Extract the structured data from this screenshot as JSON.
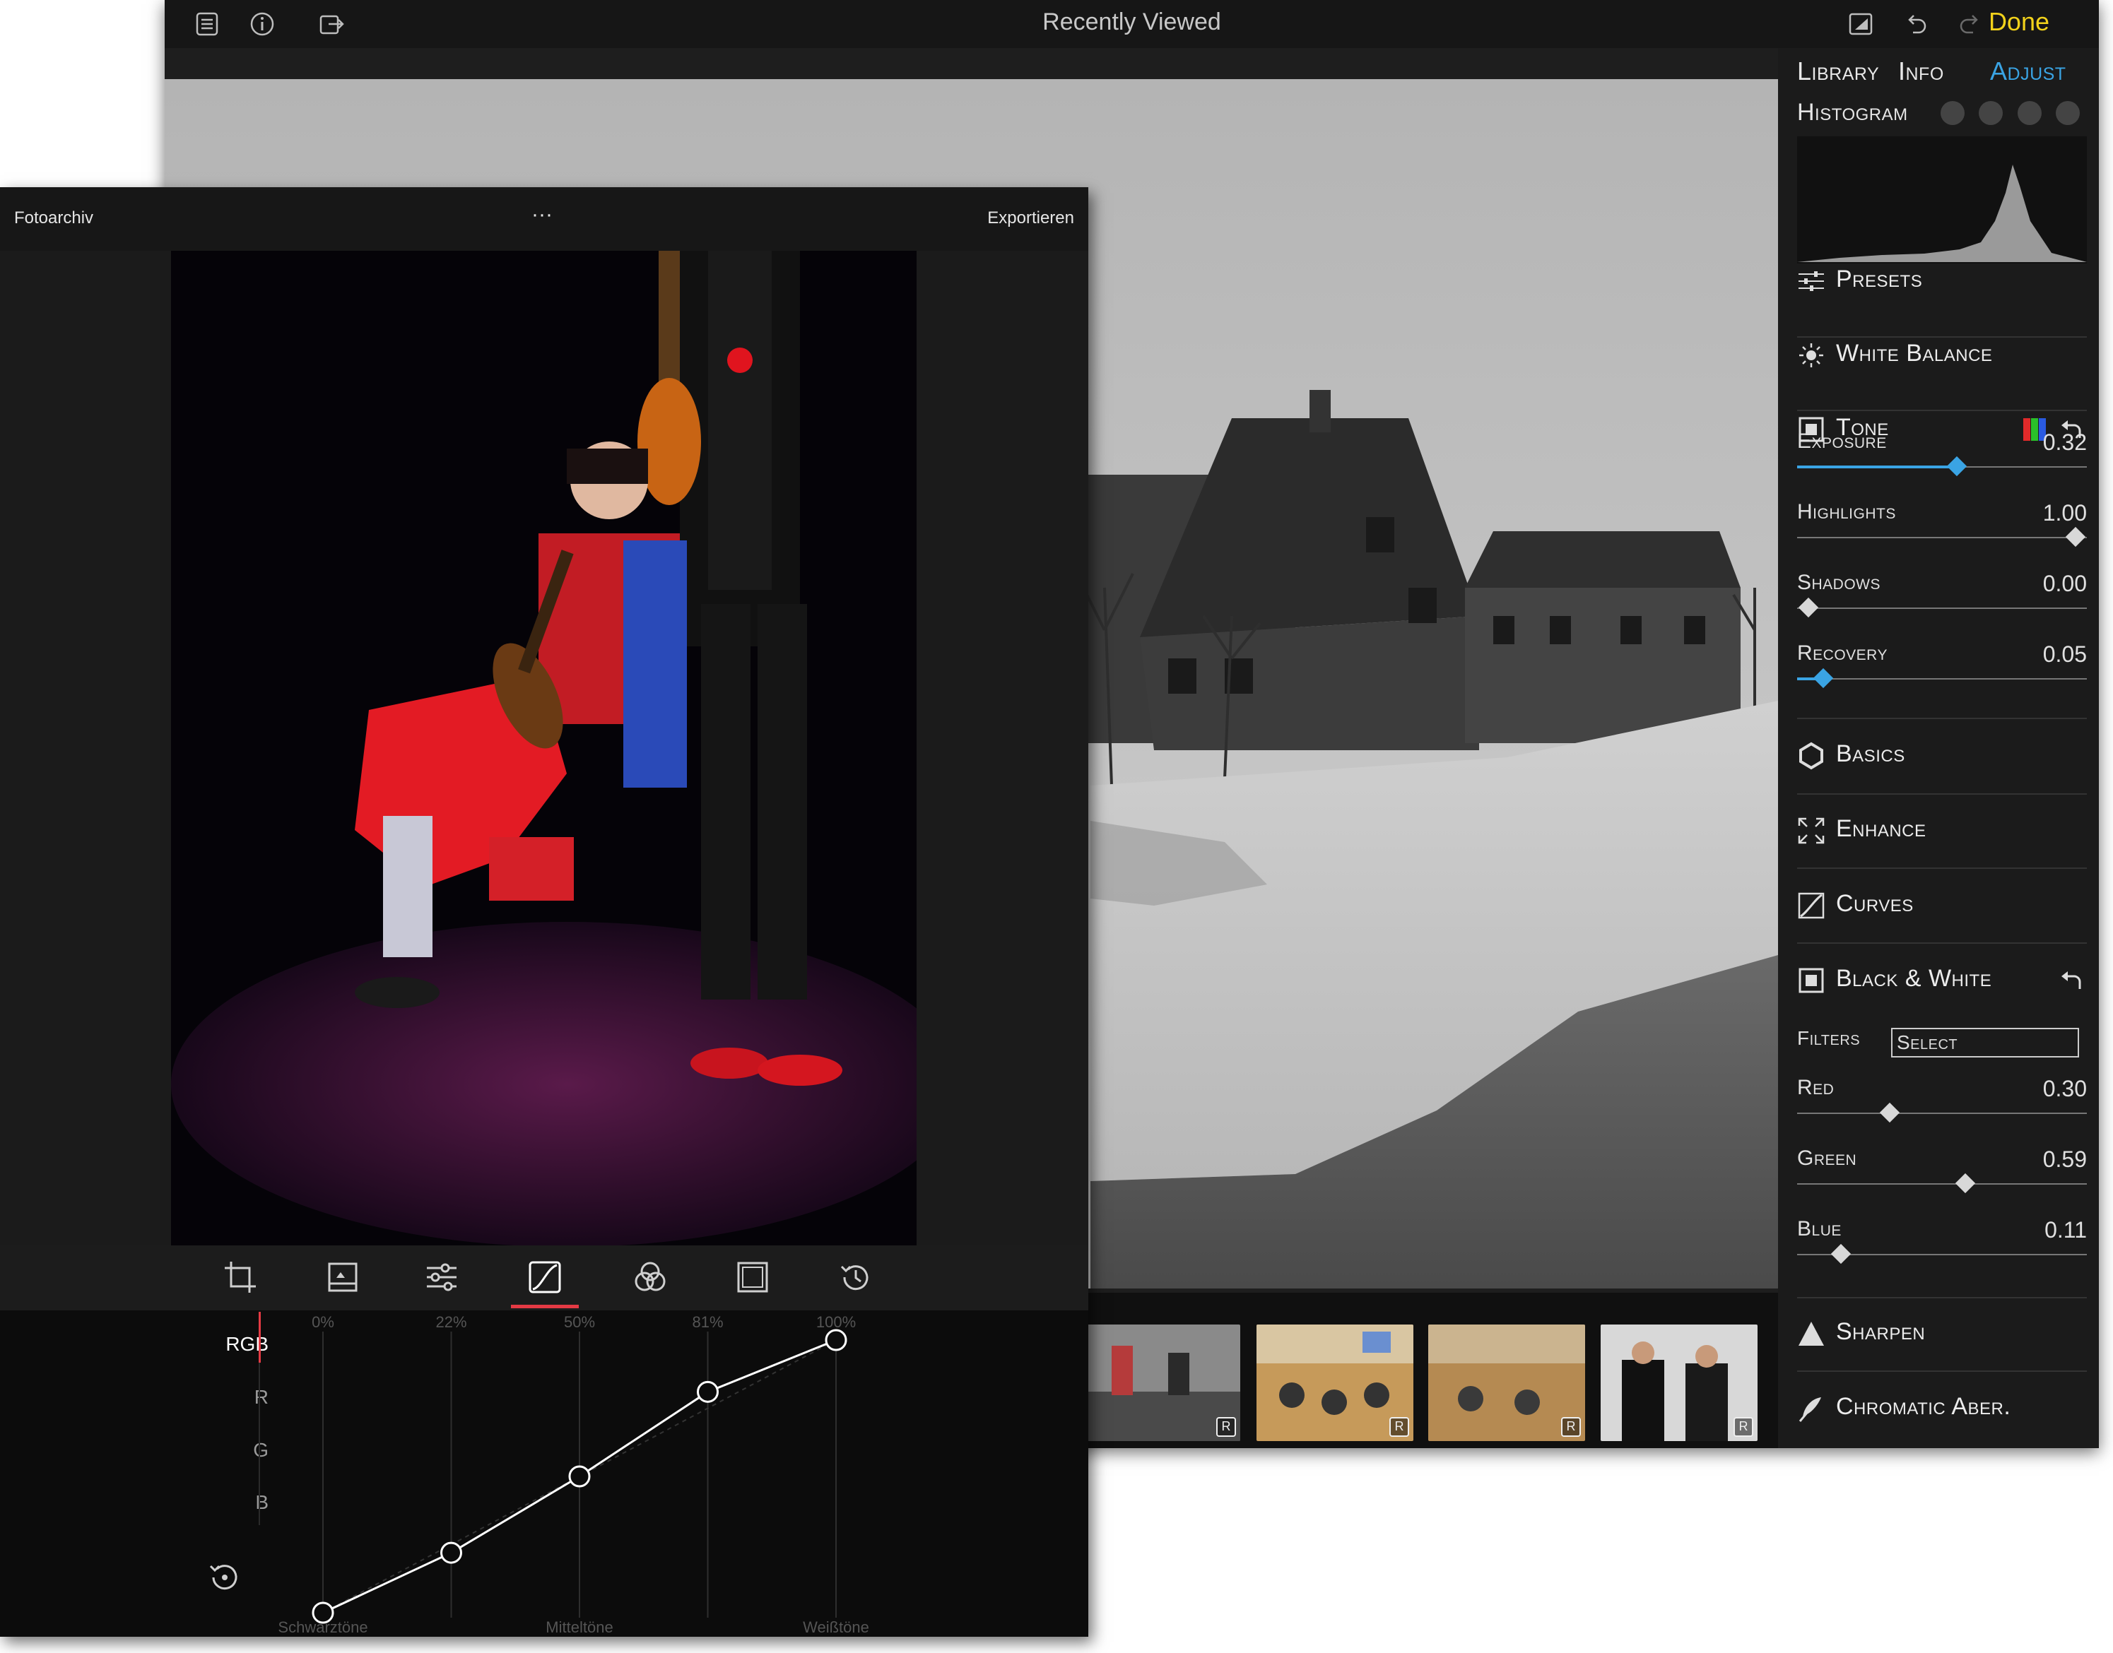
{
  "back_window": {
    "title": "Recently Viewed",
    "done_label": "Done",
    "icons": [
      "list-icon",
      "info-icon",
      "share-icon",
      "compare-icon",
      "undo-icon",
      "redo-icon"
    ],
    "filmstrip": {
      "thumbnails": [
        {
          "badge": "R"
        },
        {
          "badge": "R"
        },
        {
          "badge": "R"
        },
        {
          "badge": "R"
        }
      ]
    }
  },
  "right_panel": {
    "tabs": {
      "library": "Library",
      "info": "Info",
      "adjust": "Adjust"
    },
    "histogram_label": "Histogram",
    "sections": {
      "presets": "Presets",
      "white_balance": "White Balance",
      "tone": "Tone",
      "basics": "Basics",
      "enhance": "Enhance",
      "curves": "Curves",
      "black_white": "Black & White",
      "sharpen": "Sharpen",
      "chromatic": "Chromatic Aber."
    },
    "tone_sliders": [
      {
        "name": "Exposure",
        "value": "0.32",
        "position": 0.55,
        "color": "blue"
      },
      {
        "name": "Highlights",
        "value": "1.00",
        "position": 0.96,
        "color": "gray"
      },
      {
        "name": "Shadows",
        "value": "0.00",
        "position": 0.04,
        "color": "gray"
      },
      {
        "name": "Recovery",
        "value": "0.05",
        "position": 0.09,
        "color": "blue"
      }
    ],
    "filters_label": "Filters",
    "filters_select": "Select",
    "bw_sliders": [
      {
        "name": "Red",
        "value": "0.30",
        "position": 0.32
      },
      {
        "name": "Green",
        "value": "0.59",
        "position": 0.58
      },
      {
        "name": "Blue",
        "value": "0.11",
        "position": 0.15
      }
    ],
    "accent_color": "#3aa4e4",
    "done_color": "#f2d21b"
  },
  "front_window": {
    "title": "Fotoarchiv",
    "more_label": "···",
    "export_label": "Exportieren",
    "tools": [
      "crop-icon",
      "image-icon",
      "sliders-icon",
      "curves-icon",
      "color-mix-icon",
      "vignette-icon",
      "history-icon"
    ],
    "active_tool_color": "#e43a44",
    "channels": [
      "RGB",
      "R",
      "G",
      "B"
    ],
    "active_channel": "RGB",
    "curve_top_labels": [
      "0%",
      "22%",
      "50%",
      "81%",
      "100%"
    ],
    "curve_bottom_labels": [
      "Schwarztöne",
      "Mitteltöne",
      "Weißtöne"
    ],
    "curve_points": [
      {
        "input": 0,
        "output": 0
      },
      {
        "input": 25,
        "output": 22
      },
      {
        "input": 50,
        "output": 50
      },
      {
        "input": 75,
        "output": 81
      },
      {
        "input": 100,
        "output": 100
      }
    ]
  }
}
